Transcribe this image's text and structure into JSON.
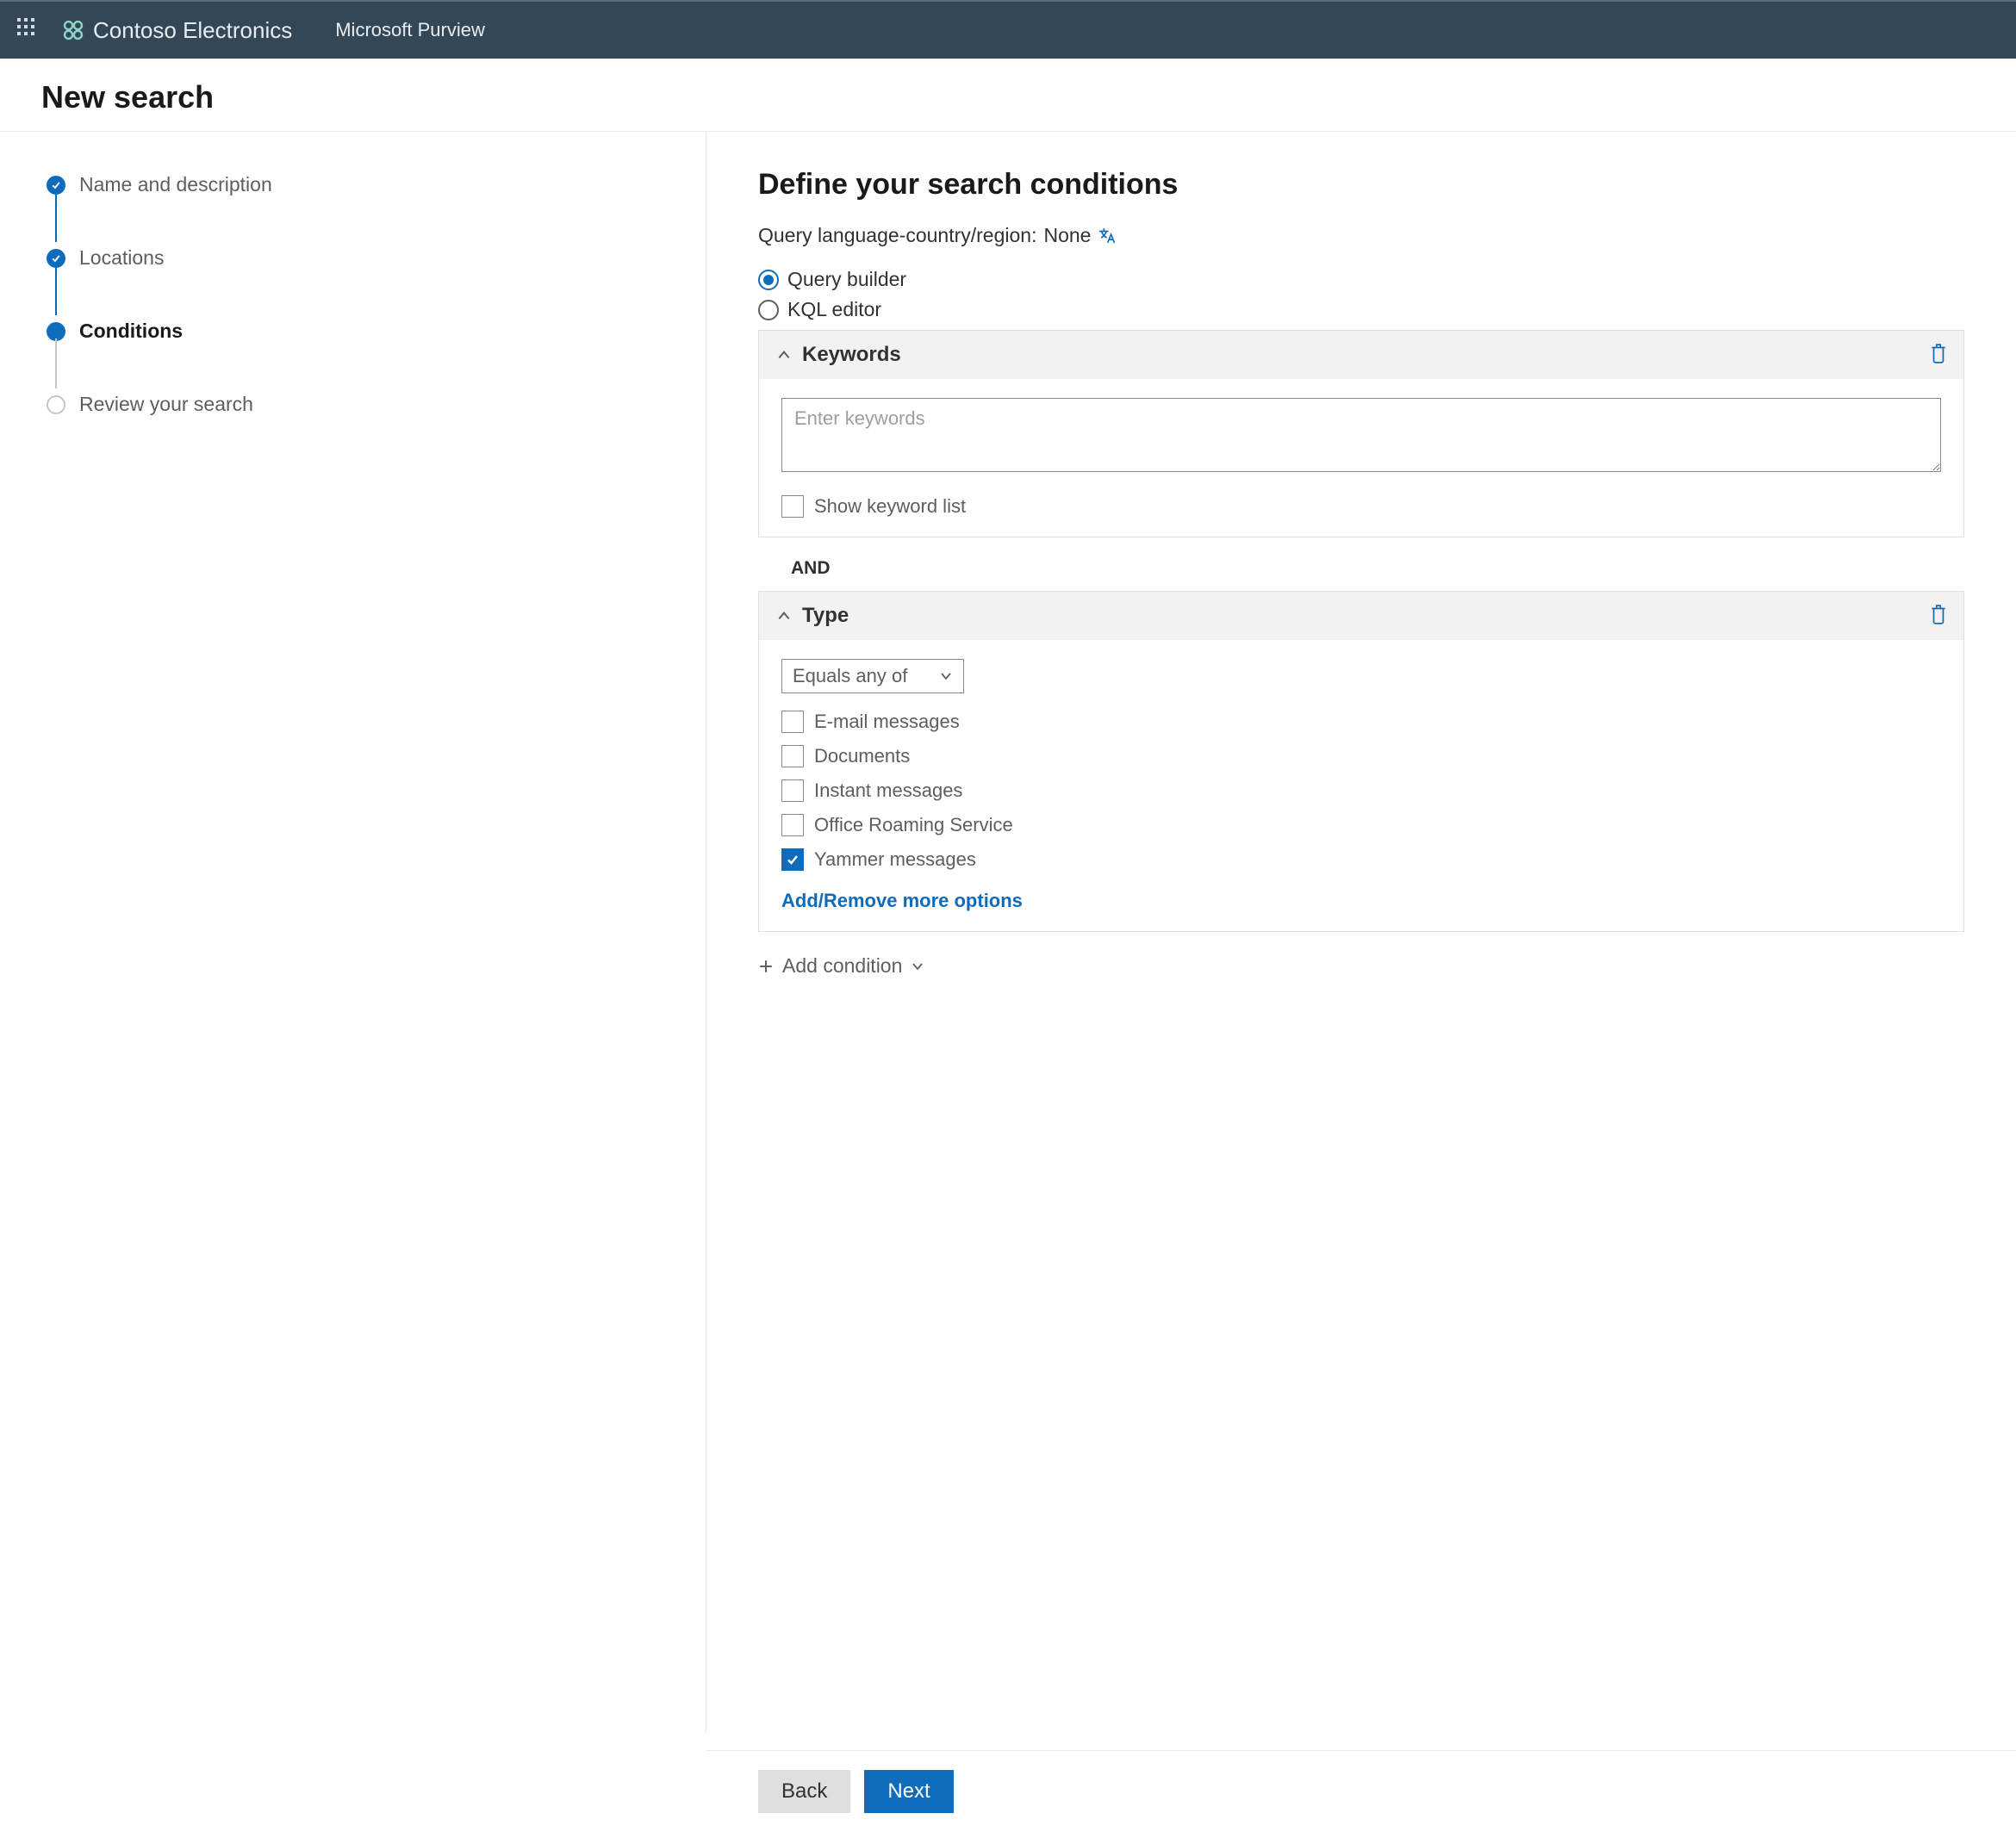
{
  "header": {
    "org_name": "Contoso Electronics",
    "product": "Microsoft Purview"
  },
  "page_title": "New search",
  "stepper": [
    {
      "label": "Name and description",
      "state": "done"
    },
    {
      "label": "Locations",
      "state": "done"
    },
    {
      "label": "Conditions",
      "state": "current"
    },
    {
      "label": "Review your search",
      "state": "pending"
    }
  ],
  "main": {
    "heading": "Define your search conditions",
    "lang_label": "Query language-country/region:",
    "lang_value": "None",
    "radio_options": {
      "query_builder": "Query builder",
      "kql_editor": "KQL editor",
      "selected": "query_builder"
    },
    "keywords_card": {
      "title": "Keywords",
      "placeholder": "Enter keywords",
      "value": "",
      "show_list_label": "Show keyword list",
      "show_list_checked": false
    },
    "join_op": "AND",
    "type_card": {
      "title": "Type",
      "operator": "Equals any of",
      "options": [
        {
          "label": "E-mail messages",
          "checked": false
        },
        {
          "label": "Documents",
          "checked": false
        },
        {
          "label": "Instant messages",
          "checked": false
        },
        {
          "label": "Office Roaming Service",
          "checked": false
        },
        {
          "label": "Yammer messages",
          "checked": true
        }
      ],
      "more_link": "Add/Remove more options"
    },
    "add_condition": "Add condition"
  },
  "footer": {
    "back": "Back",
    "next": "Next"
  }
}
